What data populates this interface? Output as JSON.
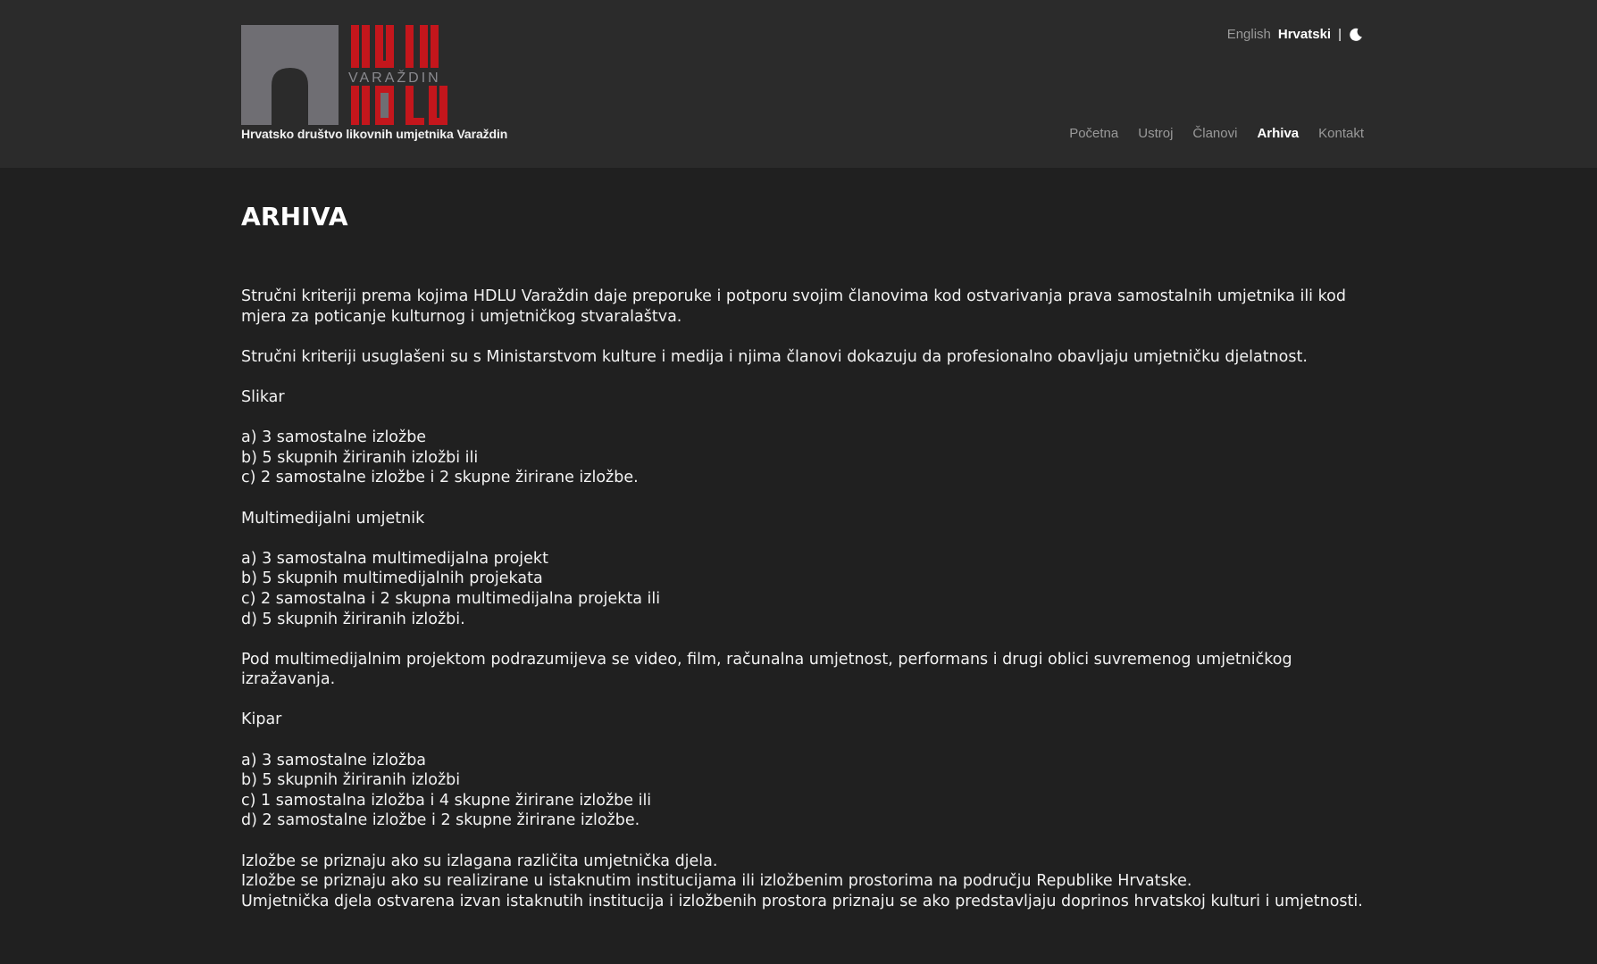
{
  "header": {
    "logo_text": "HDLU VARAŽDIN",
    "tagline": "Hrvatsko društvo likovnih umjetnika Varaždin",
    "lang": {
      "english": "English",
      "hrvatski": "Hrvatski",
      "separator": "|",
      "theme_icon": "moon-icon"
    },
    "nav": [
      {
        "label": "Početna"
      },
      {
        "label": "Ustroj"
      },
      {
        "label": "Članovi"
      },
      {
        "label": "Arhiva"
      },
      {
        "label": "Kontakt"
      }
    ]
  },
  "main": {
    "title": "ARHIVA",
    "paragraphs": [
      [
        "Stručni kriteriji prema kojima HDLU Varaždin daje preporuke i potporu svojim članovima kod ostvarivanja prava samostalnih umjetnika ili kod mjera za poticanje kulturnog i umjetničkog stvaralaštva."
      ],
      [
        "Stručni kriteriji usuglašeni su s Ministarstvom kulture i medija i njima članovi dokazuju da profesionalno obavljaju umjetničku djelatnost."
      ],
      [
        "Slikar"
      ],
      [
        "a) 3 samostalne izložbe",
        "b) 5 skupnih žiriranih izložbi ili",
        "c) 2 samostalne izložbe i 2 skupne žirirane izložbe."
      ],
      [
        "Multimedijalni umjetnik"
      ],
      [
        "a) 3 samostalna multimedijalna projekt",
        "b) 5 skupnih multimedijalnih projekata",
        "c) 2 samostalna i 2 skupna multimedijalna projekta ili",
        "d) 5 skupnih žiriranih izložbi."
      ],
      [
        "Pod multimedijalnim projektom podrazumijeva se video, film, računalna umjetnost, performans i drugi oblici suvremenog umjetničkog izražavanja."
      ],
      [
        "Kipar"
      ],
      [
        "a) 3 samostalne izložba",
        "b) 5 skupnih žiriranih izložbi",
        "c) 1 samostalna izložba i 4 skupne žirirane izložbe ili",
        "d) 2 samostalne izložbe i 2 skupne žirirane izložbe."
      ],
      [
        "Izložbe se priznaju ako su izlagana različita umjetnička djela.",
        "Izložbe se priznaju ako su realizirane u istaknutim institucijama ili izložbenim prostorima na području Republike Hrvatske.",
        "Umjetnička djela ostvarena izvan istaknutih institucija i izložbenih prostora priznaju se ako predstavljaju doprinos hrvatskoj kulturi i umjetnosti."
      ]
    ]
  },
  "colors": {
    "header_bg": "#2b2b2b",
    "page_bg": "#202020",
    "logo_gray": "#6f6e73",
    "logo_red": "#c4161c"
  }
}
